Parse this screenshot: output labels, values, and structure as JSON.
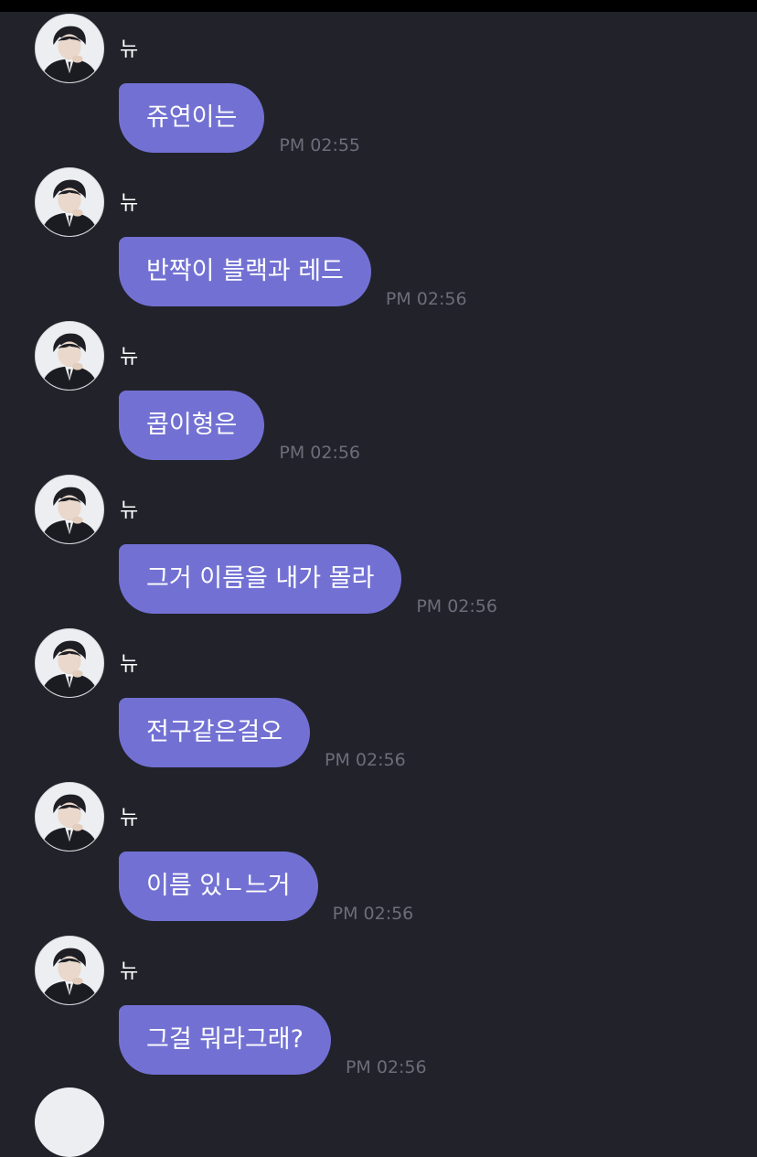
{
  "chat": {
    "messages": [
      {
        "sender": "뉴",
        "text": "쥬연이는",
        "time": "PM 02:55"
      },
      {
        "sender": "뉴",
        "text": "반짝이 블랙과 레드",
        "time": "PM 02:56"
      },
      {
        "sender": "뉴",
        "text": "콥이형은",
        "time": "PM 02:56"
      },
      {
        "sender": "뉴",
        "text": "그거 이름을 내가 몰라",
        "time": "PM 02:56"
      },
      {
        "sender": "뉴",
        "text": "전구같은걸오",
        "time": "PM 02:56"
      },
      {
        "sender": "뉴",
        "text": "이름 있ㄴ느거",
        "time": "PM 02:56"
      },
      {
        "sender": "뉴",
        "text": "그걸 뭐라그래?",
        "time": "PM 02:56"
      }
    ]
  },
  "colors": {
    "background": "#22222b",
    "bubble": "#7271d3",
    "timestamp": "#6d6d7a",
    "status_bar": "#000000"
  },
  "icons": {
    "avatar": "profile-photo"
  }
}
